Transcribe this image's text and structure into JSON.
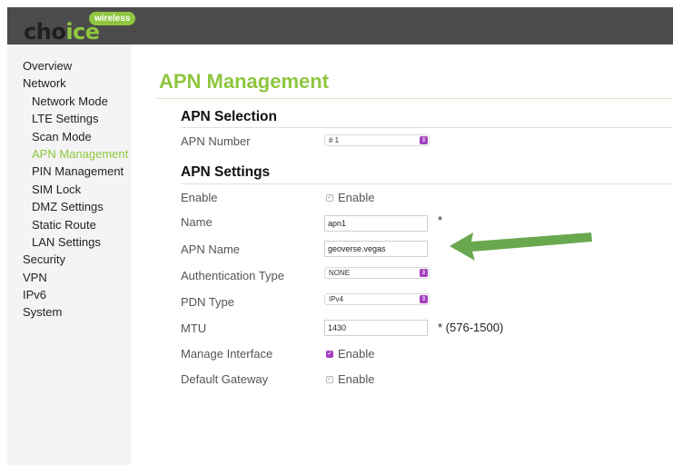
{
  "logo": {
    "word_pre": "cho",
    "word_accent": "ice",
    "badge": "wireless"
  },
  "sidebar": {
    "items": [
      {
        "label": "Overview"
      },
      {
        "label": "Network"
      },
      {
        "label": "Network Mode"
      },
      {
        "label": "LTE Settings"
      },
      {
        "label": "Scan Mode"
      },
      {
        "label": "APN Management"
      },
      {
        "label": "PIN Management"
      },
      {
        "label": "SIM Lock"
      },
      {
        "label": "DMZ Settings"
      },
      {
        "label": "Static Route"
      },
      {
        "label": "LAN Settings"
      },
      {
        "label": "Security"
      },
      {
        "label": "VPN"
      },
      {
        "label": "IPv6"
      },
      {
        "label": "System"
      }
    ]
  },
  "page": {
    "title": "APN Management",
    "selection_title": "APN Selection",
    "settings_title": "APN Settings"
  },
  "fields": {
    "apn_number": {
      "label": "APN Number",
      "value": "# 1"
    },
    "enable": {
      "label": "Enable",
      "checkbox_label": "Enable"
    },
    "name": {
      "label": "Name",
      "value": "apn1",
      "note": "*"
    },
    "apn_name": {
      "label": "APN Name",
      "value": "geoverse.vegas"
    },
    "auth_type": {
      "label": "Authentication Type",
      "value": "NONE"
    },
    "pdn_type": {
      "label": "PDN Type",
      "value": "IPv4"
    },
    "mtu": {
      "label": "MTU",
      "value": "1430",
      "note": "*  (576-1500)"
    },
    "manage_interface": {
      "label": "Manage Interface",
      "checkbox_label": "Enable"
    },
    "default_gateway": {
      "label": "Default Gateway",
      "checkbox_label": "Enable"
    }
  },
  "colors": {
    "accent": "#8ec63f",
    "header": "#4b4b4b",
    "control": "#a33fbf",
    "arrow": "#6aa84f"
  },
  "icons": {
    "select_chevron": "chevron-updown-icon",
    "check": "check-icon",
    "annotation": "arrow-left-icon"
  }
}
